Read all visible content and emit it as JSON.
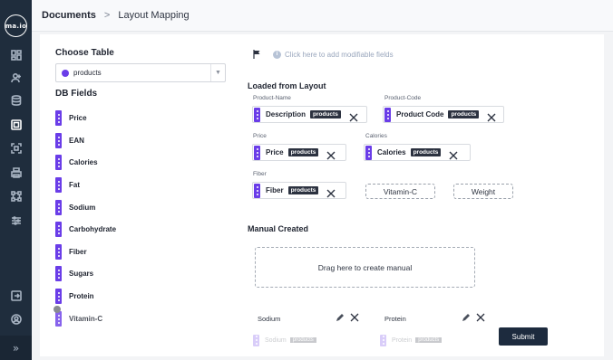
{
  "app": {
    "logo_text": "ma.io"
  },
  "sidebar": {
    "items": [
      {
        "icon": "dashboard-icon"
      },
      {
        "icon": "users-icon"
      },
      {
        "icon": "database-icon"
      },
      {
        "icon": "layout-mapping-icon",
        "active": true
      },
      {
        "icon": "scan-icon"
      },
      {
        "icon": "printer-icon"
      },
      {
        "icon": "workflow-icon"
      },
      {
        "icon": "sliders-icon"
      },
      {
        "icon": "logout-icon"
      },
      {
        "icon": "account-icon"
      }
    ],
    "expand_label": "»"
  },
  "breadcrumb": {
    "root": "Documents",
    "separator": ">",
    "current": "Layout Mapping"
  },
  "choose_table": {
    "title": "Choose Table",
    "selected": "products"
  },
  "db_fields": {
    "title": "DB Fields",
    "items": [
      "Price",
      "EAN",
      "Calories",
      "Fat",
      "Sodium",
      "Carbohydrate",
      "Fiber",
      "Sugars",
      "Protein",
      "Vitamin-C"
    ]
  },
  "hint": {
    "text": "Click here to add modifiable fields"
  },
  "loaded_from_layout": {
    "title": "Loaded from Layout",
    "slots": [
      {
        "label": "Product-Name",
        "field": "Description",
        "table": "products"
      },
      {
        "label": "Product-Code",
        "field": "Product Code",
        "table": "products"
      },
      {
        "label": "Price",
        "field": "Price",
        "table": "products"
      },
      {
        "label": "Calories",
        "field": "Calories",
        "table": "products"
      },
      {
        "label": "Fiber",
        "field": "Fiber",
        "table": "products"
      }
    ],
    "unmapped": [
      "Vitamin-C",
      "Weight"
    ]
  },
  "manual_created": {
    "title": "Manual Created",
    "dropzone": "Drag here to create manual",
    "cards": [
      {
        "label": "Sodium",
        "field": "Sodium",
        "table": "products"
      },
      {
        "label": "Protein",
        "field": "Protein",
        "table": "products"
      }
    ]
  },
  "actions": {
    "submit": "Submit"
  },
  "colors": {
    "accent": "#6a3de8",
    "sidebar": "#1f2d3d",
    "tag": "#2c3240",
    "submit": "#1d2b3e"
  }
}
